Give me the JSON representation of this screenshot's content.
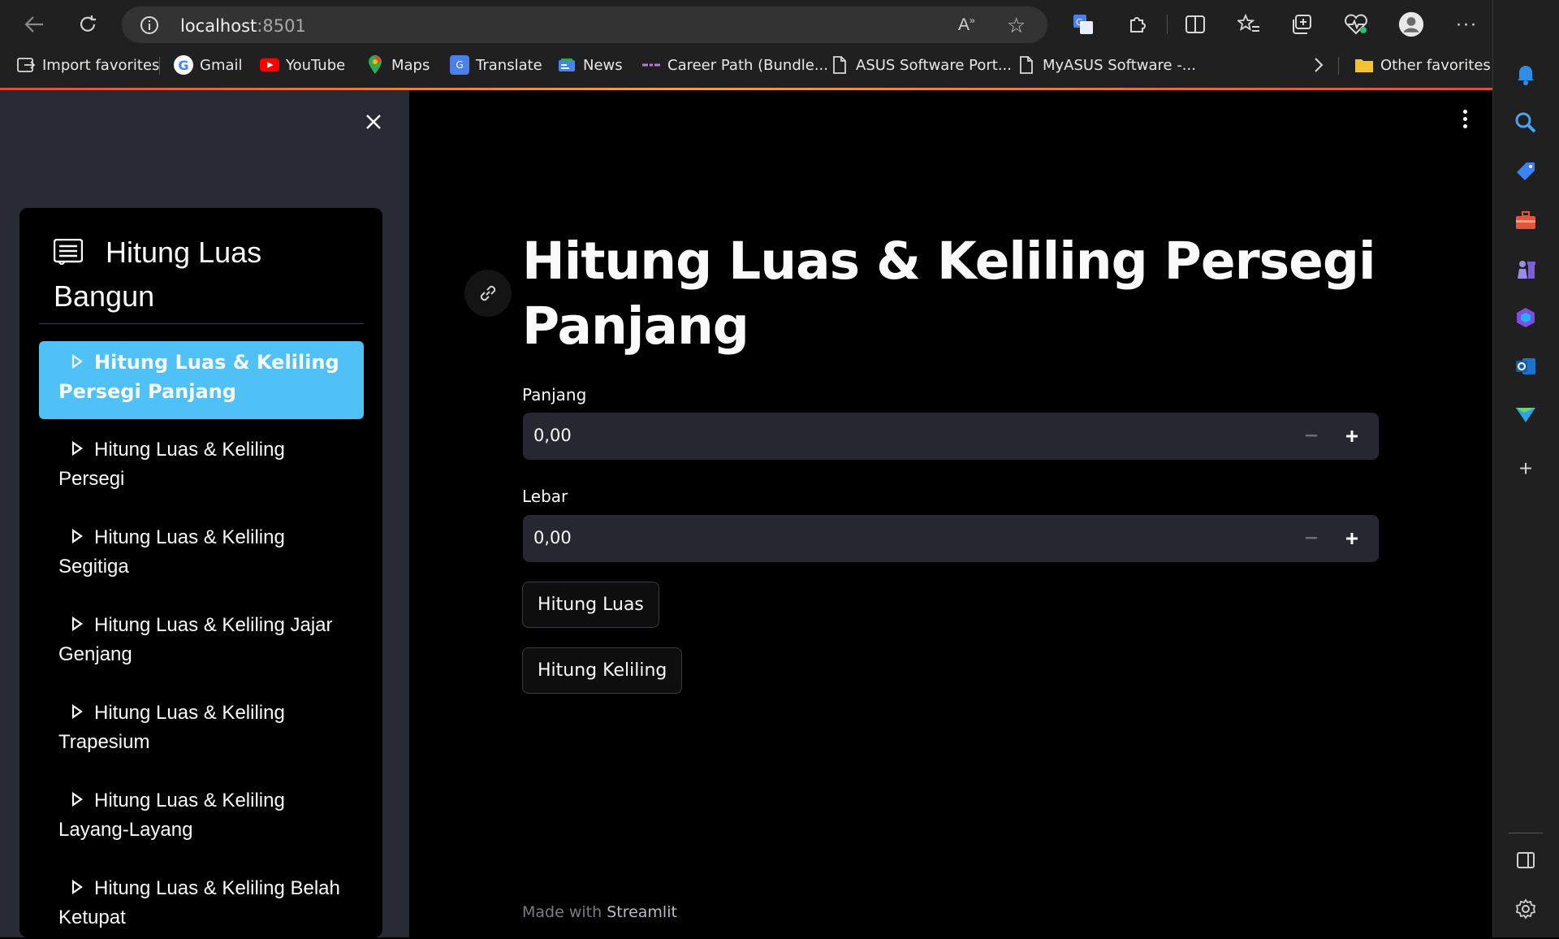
{
  "browser": {
    "url_host": "localhost",
    "url_port": ":8501",
    "bookmarks": [
      {
        "label": "Import favorites",
        "icon": "import-icon"
      },
      {
        "label": "Gmail",
        "icon": "google-icon"
      },
      {
        "label": "YouTube",
        "icon": "youtube-icon"
      },
      {
        "label": "Maps",
        "icon": "maps-icon"
      },
      {
        "label": "Translate",
        "icon": "translate-icon"
      },
      {
        "label": "News",
        "icon": "news-icon"
      },
      {
        "label": "Career Path (Bundle...",
        "icon": "career-icon"
      },
      {
        "label": "ASUS Software Port...",
        "icon": "page-icon"
      },
      {
        "label": "MyASUS Software -...",
        "icon": "page-icon"
      }
    ],
    "other_favorites": "Other favorites"
  },
  "sidebar": {
    "title": "Hitung Luas Bangun",
    "items": [
      {
        "label": "Hitung Luas & Keliling Persegi Panjang",
        "active": true
      },
      {
        "label": "Hitung Luas & Keliling Persegi",
        "active": false
      },
      {
        "label": "Hitung Luas & Keliling Segitiga",
        "active": false
      },
      {
        "label": "Hitung Luas & Keliling Jajar Genjang",
        "active": false
      },
      {
        "label": "Hitung Luas & Keliling Trapesium",
        "active": false
      },
      {
        "label": "Hitung Luas & Keliling Layang-Layang",
        "active": false
      },
      {
        "label": "Hitung Luas & Keliling Belah Ketupat",
        "active": false
      }
    ]
  },
  "main": {
    "title": "Hitung Luas & Keliling Persegi Panjang",
    "inputs": [
      {
        "label": "Panjang",
        "value": "0,00"
      },
      {
        "label": "Lebar",
        "value": "0,00"
      }
    ],
    "buttons": {
      "luas": "Hitung Luas",
      "keliling": "Hitung Keliling"
    },
    "footer_prefix": "Made with",
    "footer_brand": "Streamlit"
  },
  "colors": {
    "accent": "#4fc1f7",
    "sidebar_bg": "#272a35",
    "input_bg": "#262730"
  }
}
